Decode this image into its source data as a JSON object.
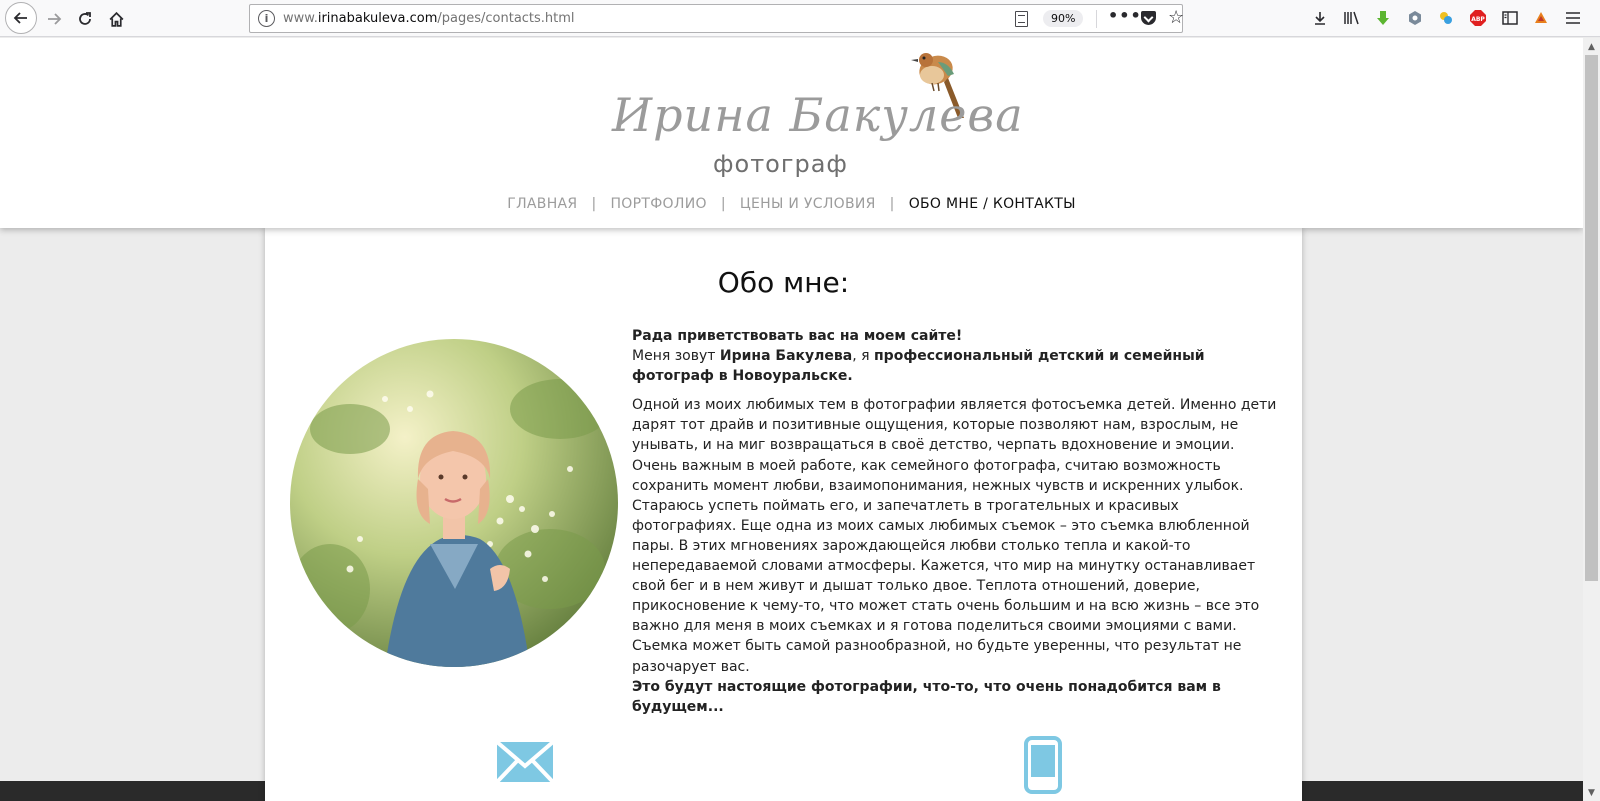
{
  "browser": {
    "url_prefix": "www.",
    "url_domain": "irinabakuleva.com",
    "url_path": "/pages/contacts.html",
    "zoom": "90%",
    "info_icon": "i",
    "more_icon": "•••"
  },
  "header": {
    "logo_name": "Ирина Бакулева",
    "logo_subtitle": "фотограф",
    "nav": [
      {
        "label": "ГЛАВНАЯ"
      },
      {
        "label": "ПОРТФОЛИО"
      },
      {
        "label": "ЦЕНЫ И УСЛОВИЯ"
      },
      {
        "label": "ОБО МНЕ / КОНТАКТЫ"
      }
    ],
    "nav_separator": "|"
  },
  "main": {
    "title": "Обо мне:",
    "greeting": "Рада приветствовать вас на моем сайте!",
    "intro_1": "Меня зовут ",
    "intro_name": "Ирина Бакулева",
    "intro_2": ", я ",
    "intro_profession": "профессиональный детский и семейный фотограф в Новоуральске.",
    "body": "Одной из моих любимых тем в фотографии является фотосъемка детей. Именно дети дарят тот драйв и позитивные ощущения, которые позволяют нам, взрослым, не унывать, и на миг возвращаться в своё детство, черпать вдохновение и эмоции. Очень важным в моей работе, как семейного фотографа, считаю возможность сохранить момент любви, взаимопонимания, нежных чувств и искренних улыбок. Стараюсь успеть поймать его, и запечатлеть в трогательных и красивых фотографиях. Еще одна из моих самых любимых съемок – это съемка влюбленной пары. В этих мгновениях зарождающейся любви столько тепла и какой-то непередаваемой словами атмосферы. Кажется, что мир на минутку останавливает свой бег и в нем живут и дышат только двое. Теплота отношений, доверие, прикосновение к чему-то, что может стать очень большим и на всю жизнь – все это важно для меня в моих съемках и я готова поделиться своими эмоциями с вами. Съемка может быть самой разнообразной, но будьте уверенны, что результат не разочарует вас.",
    "closing": "Это будут настоящие фотографии, что-то, что очень понадобится вам в будущем..."
  },
  "icons": {
    "back": "back-arrow-icon",
    "forward": "forward-arrow-icon",
    "reload": "reload-icon",
    "home": "home-icon",
    "mail": "envelope-icon",
    "phone": "mobile-phone-icon"
  },
  "colors": {
    "accent_icon": "#7ec8e3",
    "nav_active": "#111111",
    "nav_inactive": "#9c9c9c"
  }
}
